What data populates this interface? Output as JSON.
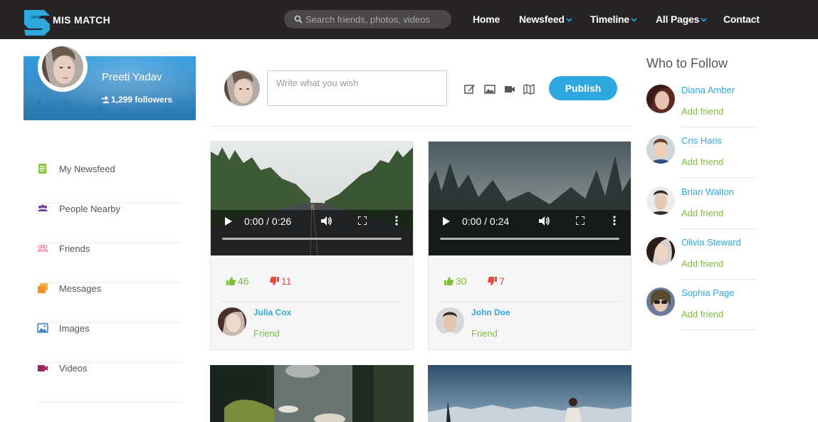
{
  "app": {
    "brand": "MIS MATCH"
  },
  "search": {
    "placeholder": "Search friends, photos, videos"
  },
  "nav": {
    "home": "Home",
    "newsfeed": "Newsfeed",
    "timeline": "Timeline",
    "all_pages": "All Pages",
    "contact": "Contact"
  },
  "profile": {
    "name": "Preeti Yadav",
    "followers": "1,299 followers"
  },
  "sidebar": {
    "items": [
      {
        "label": "My Newsfeed",
        "icon": "newsfeed-icon",
        "color": "#8dc63f"
      },
      {
        "label": "People Nearby",
        "icon": "people-icon",
        "color": "#6a3fa0"
      },
      {
        "label": "Friends",
        "icon": "friends-icon",
        "color": "#e86a8a"
      },
      {
        "label": "Messages",
        "icon": "messages-icon",
        "color": "#f0932b"
      },
      {
        "label": "Images",
        "icon": "images-icon",
        "color": "#3a7fc4"
      },
      {
        "label": "Videos",
        "icon": "videos-icon",
        "color": "#a0245e"
      }
    ]
  },
  "composer": {
    "placeholder": "Write what you wish",
    "publish": "Publish"
  },
  "posts": [
    {
      "time": "0:00 / 0:26",
      "likes": "46",
      "dislikes": "11",
      "author": "Julia Cox",
      "relation": "Friend"
    },
    {
      "time": "0:00 / 0:24",
      "likes": "30",
      "dislikes": "7",
      "author": "John Doe",
      "relation": "Friend"
    }
  ],
  "who_to_follow": {
    "title": "Who to Follow",
    "add_label": "Add friend",
    "people": [
      {
        "name": "Diana Amber"
      },
      {
        "name": "Cris Haris"
      },
      {
        "name": "Brian Walton"
      },
      {
        "name": "Olivia Steward"
      },
      {
        "name": "Sophia Page"
      }
    ]
  },
  "colors": {
    "accent": "#2ea9e0",
    "green": "#7fbe3c",
    "red": "#e94a3a",
    "topbar": "#272425"
  }
}
